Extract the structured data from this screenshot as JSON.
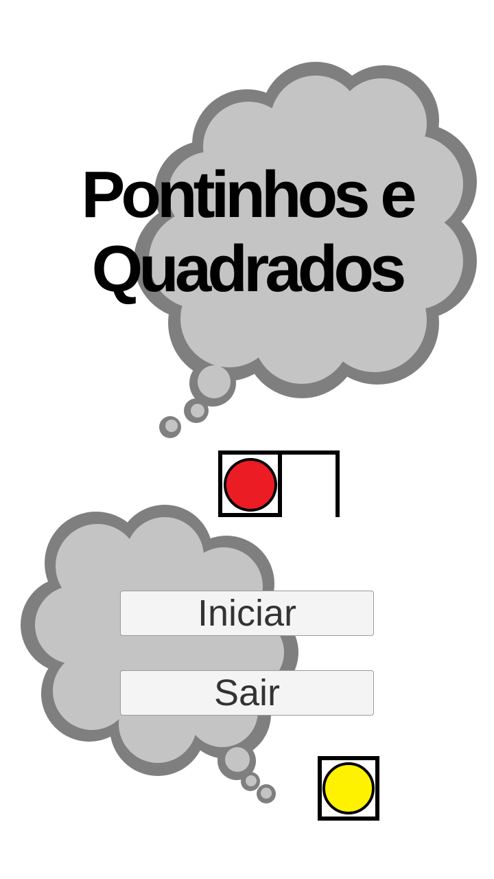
{
  "title": {
    "line1": "Pontinhos e",
    "line2": "Quadrados"
  },
  "menu": {
    "start_label": "Iniciar",
    "exit_label": "Sair"
  },
  "decorations": {
    "cloud_fill": "#c4c4c4",
    "cloud_outline": "#7f7f7f",
    "red_dot_color": "#ec1c24",
    "yellow_dot_color": "#fff200",
    "line_color": "#000000"
  }
}
